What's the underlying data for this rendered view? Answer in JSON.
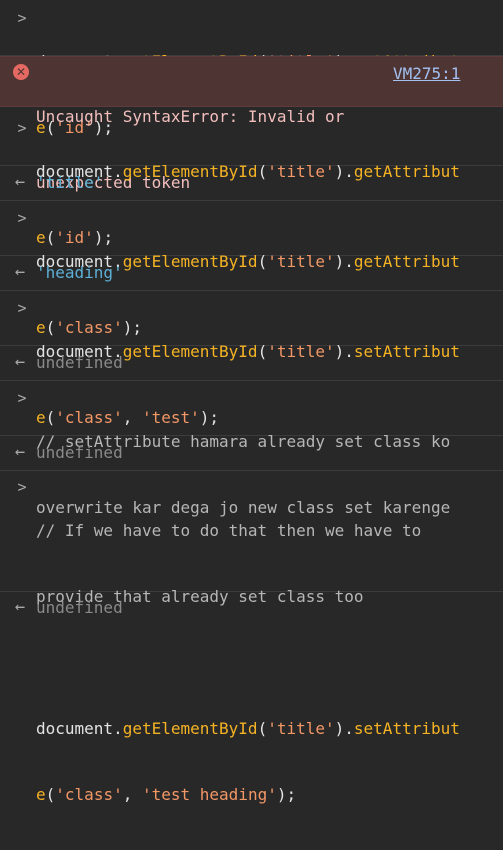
{
  "console": {
    "entries": [
      {
        "kind": "input",
        "prefix": ">",
        "line1": [
          "document",
          ".",
          "getElementById",
          "(",
          "'title'",
          ").",
          "getAttribut"
        ],
        "line2": [
          "e",
          "(",
          "'id'",
          ");"
        ]
      },
      {
        "kind": "error",
        "line1": "Uncaught SyntaxError: Invalid or",
        "line2": "unexpected token",
        "source": "VM275:1"
      },
      {
        "kind": "input",
        "prefix": ">",
        "line1": [
          "document",
          ".",
          "getElementById",
          "(",
          "'title'",
          ").",
          "getAttribut"
        ],
        "line2": [
          "e",
          "(",
          "'id'",
          ");"
        ]
      },
      {
        "kind": "output",
        "prefix": "←",
        "value": "'title'"
      },
      {
        "kind": "input",
        "prefix": ">",
        "line1": [
          "document",
          ".",
          "getElementById",
          "(",
          "'title'",
          ").",
          "getAttribut"
        ],
        "line2": [
          "e",
          "(",
          "'class'",
          ");"
        ]
      },
      {
        "kind": "output",
        "prefix": "←",
        "value": "'heading'"
      },
      {
        "kind": "input",
        "prefix": ">",
        "line1": [
          "document",
          ".",
          "getElementById",
          "(",
          "'title'",
          ").",
          "setAttribut"
        ],
        "line2": [
          "e",
          "(",
          "'class'",
          ", ",
          "'test'",
          ");"
        ]
      },
      {
        "kind": "output",
        "prefix": "←",
        "value": "undefined"
      },
      {
        "kind": "input",
        "prefix": ">",
        "comment1": "// setAttribute hamara already set class ko",
        "comment2": "overwrite kar dega jo new class set karenge"
      },
      {
        "kind": "output",
        "prefix": "←",
        "value": "undefined"
      },
      {
        "kind": "input",
        "prefix": ">",
        "comment1": "// If we have to do that then we have to",
        "comment2": "provide that already set class too",
        "line1": [
          "document",
          ".",
          "getElementById",
          "(",
          "'title'",
          ").",
          "setAttribut"
        ],
        "line2": [
          "e",
          "(",
          "'class'",
          ", ",
          "'test heading'",
          ");"
        ]
      },
      {
        "kind": "output",
        "prefix": "←",
        "value": "undefined"
      }
    ],
    "error_icon": "error-circle-icon",
    "colors": {
      "background": "#282828",
      "error_background": "#4e3534",
      "method": "#f5b324",
      "string": "#f29766",
      "output_string": "#5db0d7",
      "undefined": "#8a8a8a",
      "link": "#a2c1f2"
    }
  }
}
